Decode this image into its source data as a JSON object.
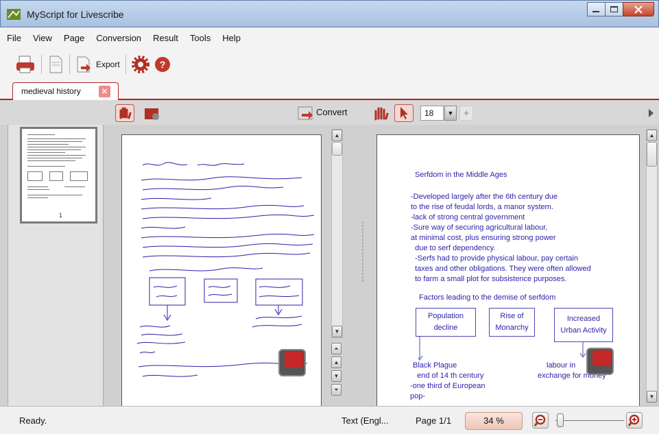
{
  "window": {
    "title": "MyScript for Livescribe"
  },
  "menubar": {
    "items": [
      "File",
      "View",
      "Page",
      "Conversion",
      "Result",
      "Tools",
      "Help"
    ]
  },
  "toolbar": {
    "export_label": "Export",
    "icons": [
      "print-icon",
      "page-icon",
      "export-icon",
      "settings-gear-icon",
      "help-icon"
    ]
  },
  "tabs": [
    {
      "label": "medieval history",
      "active": true
    }
  ],
  "subtoolbar": {
    "convert_label": "Convert",
    "font_size": "18",
    "plus_label": "+"
  },
  "thumbnail": {
    "page_number": "1"
  },
  "conversion": {
    "title": "Serfdom in the Middle Ages",
    "lines": [
      "-Developed largely after the 6th century due",
      "to the rise of feudal lords, a manor system.",
      "-lack of strong central government",
      "-Sure way of securing agricultural labour,",
      "at minimal cost, plus ensuring strong power",
      "  due to serf dependency.",
      "  -Serfs had to provide physical labour, pay certain",
      "  taxes and other obligations. They were often allowed",
      "  to farm a small plot for subsistence purposes."
    ],
    "factors_heading": "Factors leading to the demise of serfdom",
    "boxes": [
      "Population\ndecline",
      "Rise of\nMonarchy",
      "Increased\nUrban Activity"
    ],
    "box_lines": [
      [
        "Population",
        "decline"
      ],
      [
        "Rise of",
        "Monarchy"
      ],
      [
        "Increased",
        "Urban Activity"
      ]
    ],
    "bottom_left": [
      "Black Plague",
      "  end of 14 th century",
      "-one third of European",
      "pop-"
    ],
    "bottom_right": [
      "labour in",
      "exchange for money"
    ]
  },
  "status": {
    "ready": "Ready.",
    "language": "Text (Engl...",
    "page": "Page 1/1",
    "zoom": "34 %"
  },
  "colors": {
    "accent": "#b22222",
    "ink": "#2b1fa8"
  }
}
